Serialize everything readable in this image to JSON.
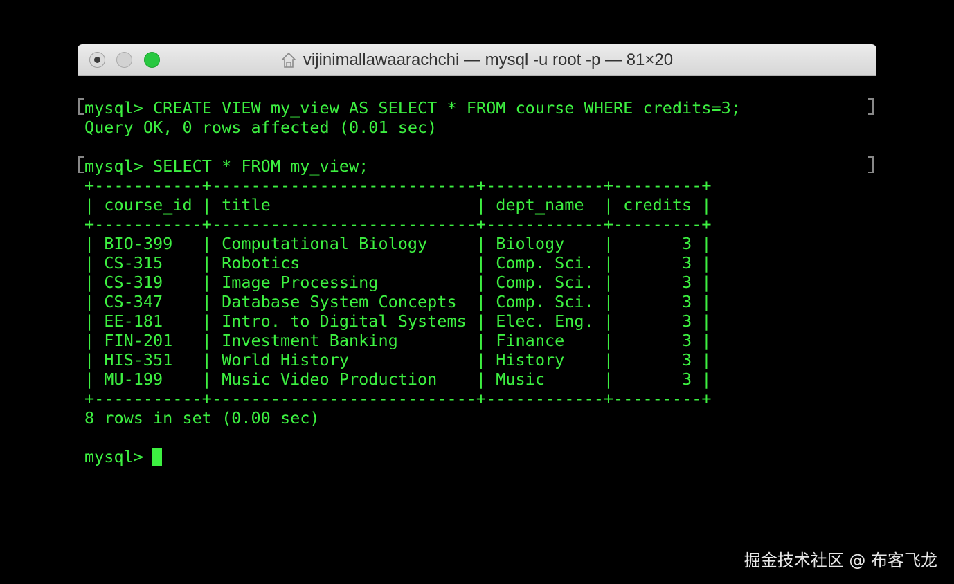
{
  "window": {
    "title": "vijinimallawaarachchi — mysql -u root -p — 81×20"
  },
  "terminal": {
    "lines": [
      "mysql> CREATE VIEW my_view AS SELECT * FROM course WHERE credits=3;",
      "Query OK, 0 rows affected (0.01 sec)",
      "",
      "mysql> SELECT * FROM my_view;",
      "+-----------+---------------------------+------------+---------+",
      "| course_id | title                     | dept_name  | credits |",
      "+-----------+---------------------------+------------+---------+",
      "| BIO-399   | Computational Biology     | Biology    |       3 |",
      "| CS-315    | Robotics                  | Comp. Sci. |       3 |",
      "| CS-319    | Image Processing          | Comp. Sci. |       3 |",
      "| CS-347    | Database System Concepts  | Comp. Sci. |       3 |",
      "| EE-181    | Intro. to Digital Systems | Elec. Eng. |       3 |",
      "| FIN-201   | Investment Banking        | Finance    |       3 |",
      "| HIS-351   | World History             | History    |       3 |",
      "| MU-199    | Music Video Production    | Music      |       3 |",
      "+-----------+---------------------------+------------+---------+",
      "8 rows in set (0.00 sec)",
      "",
      "mysql> "
    ]
  },
  "watermark": "掘金技术社区 @ 布客飞龙",
  "colors": {
    "terminal_text": "#3df041",
    "terminal_bg": "#000000",
    "titlebar": "#e0e0e0"
  }
}
